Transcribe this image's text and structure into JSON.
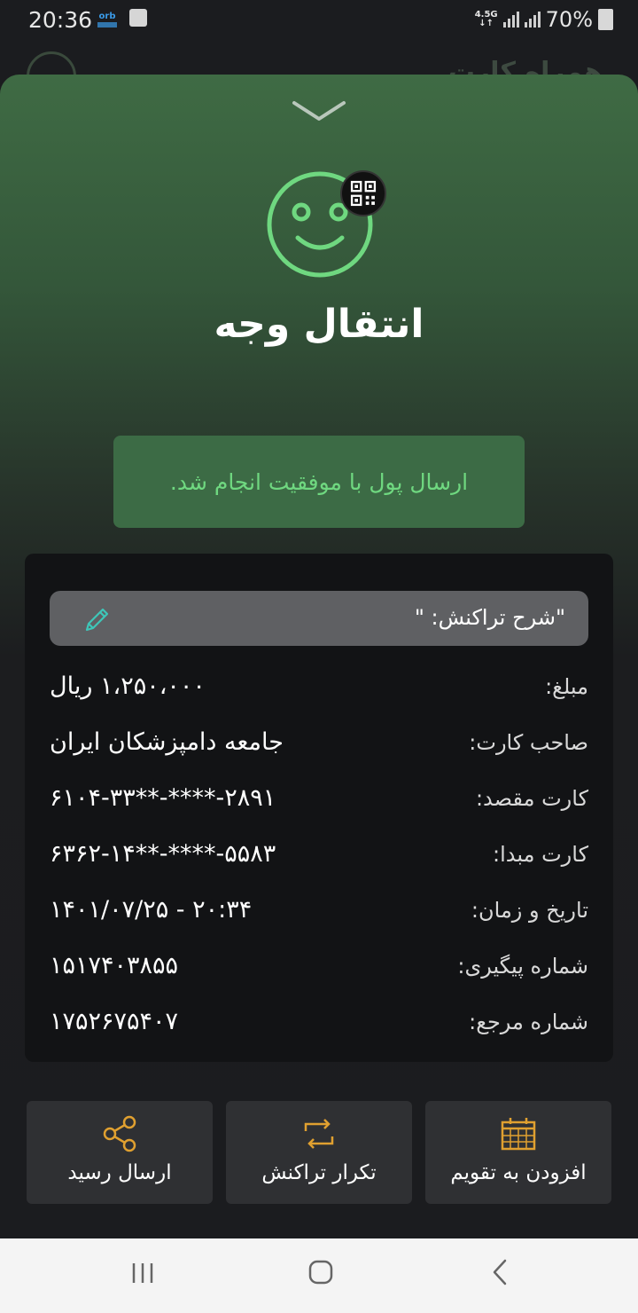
{
  "status_bar": {
    "time": "20:36",
    "network": "4.5G",
    "battery": "70%",
    "carrier_logo": "orb"
  },
  "background_app": {
    "title": "همراه کارت"
  },
  "sheet": {
    "title": "انتقال وجه",
    "success_message": "ارسال پول با موفقیت انجام شد.",
    "description_label": "\"شرح تراکنش: \"",
    "rows": [
      {
        "label": "مبلغ:",
        "value": "۱،۲۵۰،۰۰۰ ریال"
      },
      {
        "label": "صاحب کارت:",
        "value": "جامعه دامپزشکان ایران"
      },
      {
        "label": "کارت مقصد:",
        "value": "۶۱۰۴-۳۳**-****-۲۸۹۱"
      },
      {
        "label": "کارت مبدا:",
        "value": "۶۳۶۲-۱۴**-****-۵۵۸۳"
      },
      {
        "label": "تاریخ و زمان:",
        "value": "۱۴۰۱/۰۷/۲۵ - ۲۰:۳۴"
      },
      {
        "label": "شماره پیگیری:",
        "value": "۱۵۱۷۴۰۳۸۵۵"
      },
      {
        "label": "شماره مرجع:",
        "value": "۱۷۵۲۶۷۵۴۰۷"
      }
    ],
    "actions": {
      "share": "ارسال رسید",
      "repeat": "تکرار تراکنش",
      "calendar": "افزودن به تقویم"
    }
  },
  "colors": {
    "accent_green": "#6fd880",
    "success_bg": "#3c6b45",
    "icon_orange": "#e0a030",
    "edit_icon": "#3ec6b8"
  },
  "icons": {
    "chevron": "chevron-down-icon",
    "face": "smiley-face-icon",
    "qr": "qr-code-icon",
    "edit": "pencil-icon",
    "share": "share-icon",
    "repeat": "repeat-icon",
    "calendar": "calendar-icon"
  }
}
